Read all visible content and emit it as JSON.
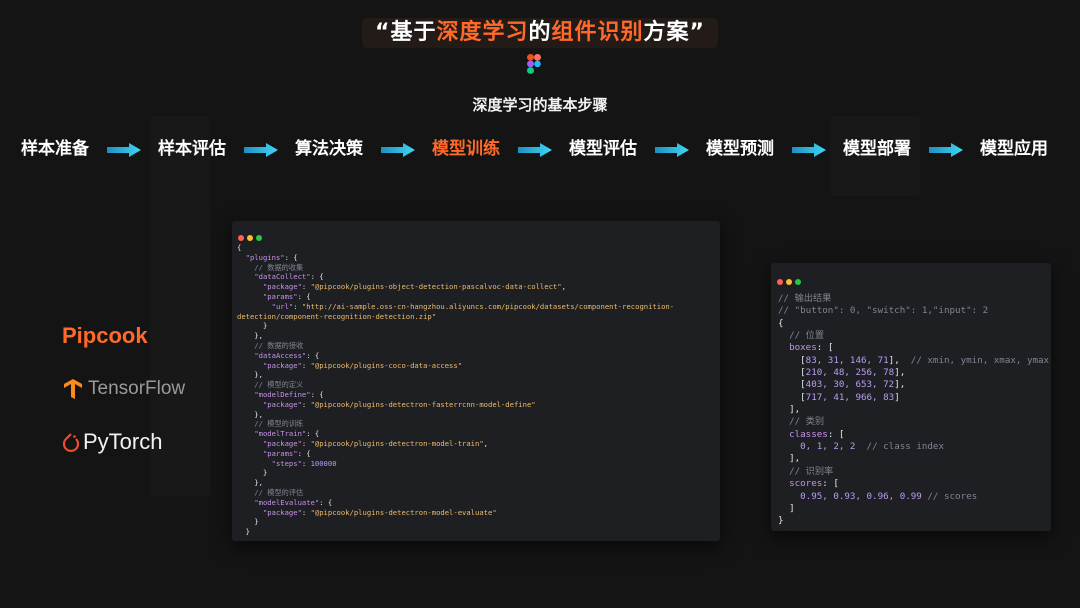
{
  "slide": {
    "title_prefix": "“基于",
    "title_highlight_1": "深度学习",
    "title_mid": "的",
    "title_highlight_2": "组件识别",
    "title_suffix": "方案”",
    "subtitle": "深度学习的基本步骤"
  },
  "steps": [
    {
      "label": "样本准备",
      "active": false
    },
    {
      "label": "样本评估",
      "active": false
    },
    {
      "label": "算法决策",
      "active": false
    },
    {
      "label": "模型训练",
      "active": true
    },
    {
      "label": "模型评估",
      "active": false
    },
    {
      "label": "模型预测",
      "active": false
    },
    {
      "label": "模型部署",
      "active": false
    },
    {
      "label": "模型应用",
      "active": false
    }
  ],
  "colors": {
    "accent": "#ff6a2a",
    "arrow": "#2bc0e4",
    "background": "#141414",
    "code_bg": "#1e1f23"
  },
  "logos": {
    "pipcook": "Pipcook",
    "tensorflow": "TensorFlow",
    "pytorch": "PyTorch"
  },
  "code_left": [
    [
      [
        "p",
        "{"
      ]
    ],
    [
      [
        "p",
        "  "
      ],
      [
        "k",
        "\"plugins\""
      ],
      [
        "p",
        ": {"
      ]
    ],
    [
      [
        "c",
        "    // 数据的收集"
      ]
    ],
    [
      [
        "p",
        "    "
      ],
      [
        "k",
        "\"dataCollect\""
      ],
      [
        "p",
        ": {"
      ]
    ],
    [
      [
        "p",
        "      "
      ],
      [
        "k",
        "\"package\""
      ],
      [
        "p",
        ": "
      ],
      [
        "s",
        "\"@pipcook/plugins-object-detection-pascalvoc-data-collect\""
      ],
      [
        "p",
        ","
      ]
    ],
    [
      [
        "p",
        "      "
      ],
      [
        "k",
        "\"params\""
      ],
      [
        "p",
        ": {"
      ]
    ],
    [
      [
        "p",
        "        "
      ],
      [
        "k",
        "\"url\""
      ],
      [
        "p",
        ": "
      ],
      [
        "s",
        "\"http://ai-sample.oss-cn-hangzhou.aliyuncs.com/pipcook/datasets/component-recognition-"
      ]
    ],
    [
      [
        "s",
        "detection/component-recognition-detection.zip\""
      ]
    ],
    [
      [
        "p",
        "      }"
      ]
    ],
    [
      [
        "p",
        "    },"
      ]
    ],
    [
      [
        "c",
        "    // 数据的接收"
      ]
    ],
    [
      [
        "p",
        "    "
      ],
      [
        "k",
        "\"dataAccess\""
      ],
      [
        "p",
        ": {"
      ]
    ],
    [
      [
        "p",
        "      "
      ],
      [
        "k",
        "\"package\""
      ],
      [
        "p",
        ": "
      ],
      [
        "s",
        "\"@pipcook/plugins-coco-data-access\""
      ]
    ],
    [
      [
        "p",
        "    },"
      ]
    ],
    [
      [
        "c",
        "    // 模型的定义"
      ]
    ],
    [
      [
        "p",
        "    "
      ],
      [
        "k",
        "\"modelDefine\""
      ],
      [
        "p",
        ": {"
      ]
    ],
    [
      [
        "p",
        "      "
      ],
      [
        "k",
        "\"package\""
      ],
      [
        "p",
        ": "
      ],
      [
        "s",
        "\"@pipcook/plugins-detectron-fasterrcnn-model-define\""
      ]
    ],
    [
      [
        "p",
        "    },"
      ]
    ],
    [
      [
        "c",
        "    // 模型的训练"
      ]
    ],
    [
      [
        "p",
        "    "
      ],
      [
        "k",
        "\"modelTrain\""
      ],
      [
        "p",
        ": {"
      ]
    ],
    [
      [
        "p",
        "      "
      ],
      [
        "k",
        "\"package\""
      ],
      [
        "p",
        ": "
      ],
      [
        "s",
        "\"@pipcook/plugins-detectron-model-train\""
      ],
      [
        "p",
        ","
      ]
    ],
    [
      [
        "p",
        "      "
      ],
      [
        "k",
        "\"params\""
      ],
      [
        "p",
        ": {"
      ]
    ],
    [
      [
        "p",
        "        "
      ],
      [
        "k",
        "\"steps\""
      ],
      [
        "p",
        ": "
      ],
      [
        "n",
        "100000"
      ]
    ],
    [
      [
        "p",
        "      }"
      ]
    ],
    [
      [
        "p",
        "    },"
      ]
    ],
    [
      [
        "c",
        "    // 模型的评估"
      ]
    ],
    [
      [
        "p",
        "    "
      ],
      [
        "k",
        "\"modelEvaluate\""
      ],
      [
        "p",
        ": {"
      ]
    ],
    [
      [
        "p",
        "      "
      ],
      [
        "k",
        "\"package\""
      ],
      [
        "p",
        ": "
      ],
      [
        "s",
        "\"@pipcook/plugins-detectron-model-evaluate\""
      ]
    ],
    [
      [
        "p",
        "    }"
      ]
    ],
    [
      [
        "p",
        "  }"
      ]
    ]
  ],
  "code_right": [
    [
      [
        "c",
        "// 输出结果"
      ]
    ],
    [
      [
        "c",
        "// \"button\": 0, \"switch\": 1,\"input\": 2"
      ]
    ],
    [
      [
        "p",
        "{"
      ]
    ],
    [
      [
        "c",
        "  // 位置"
      ]
    ],
    [
      [
        "p",
        "  "
      ],
      [
        "k",
        "boxes"
      ],
      [
        "p",
        ": ["
      ]
    ],
    [
      [
        "p",
        "    ["
      ],
      [
        "n",
        "83, 31, 146, 71"
      ],
      [
        "p",
        "],  "
      ],
      [
        "c",
        "// xmin, ymin, xmax, ymax"
      ]
    ],
    [
      [
        "p",
        "    ["
      ],
      [
        "n",
        "210, 48, 256, 78"
      ],
      [
        "p",
        "],"
      ]
    ],
    [
      [
        "p",
        "    ["
      ],
      [
        "n",
        "403, 30, 653, 72"
      ],
      [
        "p",
        "],"
      ]
    ],
    [
      [
        "p",
        "    ["
      ],
      [
        "n",
        "717, 41, 966, 83"
      ],
      [
        "p",
        "]"
      ]
    ],
    [
      [
        "p",
        "  ],"
      ]
    ],
    [
      [
        "c",
        "  // 类别"
      ]
    ],
    [
      [
        "p",
        "  "
      ],
      [
        "k",
        "classes"
      ],
      [
        "p",
        ": ["
      ]
    ],
    [
      [
        "p",
        "    "
      ],
      [
        "n",
        "0, 1, 2, 2"
      ],
      [
        "p",
        "  "
      ],
      [
        "c",
        "// class index"
      ]
    ],
    [
      [
        "p",
        "  ],"
      ]
    ],
    [
      [
        "c",
        "  // 识别率"
      ]
    ],
    [
      [
        "p",
        "  "
      ],
      [
        "k",
        "scores"
      ],
      [
        "p",
        ": ["
      ]
    ],
    [
      [
        "p",
        "    "
      ],
      [
        "n",
        "0.95, 0.93, 0.96, 0.99"
      ],
      [
        "p",
        " "
      ],
      [
        "c",
        "// scores"
      ]
    ],
    [
      [
        "p",
        "  ]"
      ]
    ],
    [
      [
        "p",
        "}"
      ]
    ]
  ]
}
